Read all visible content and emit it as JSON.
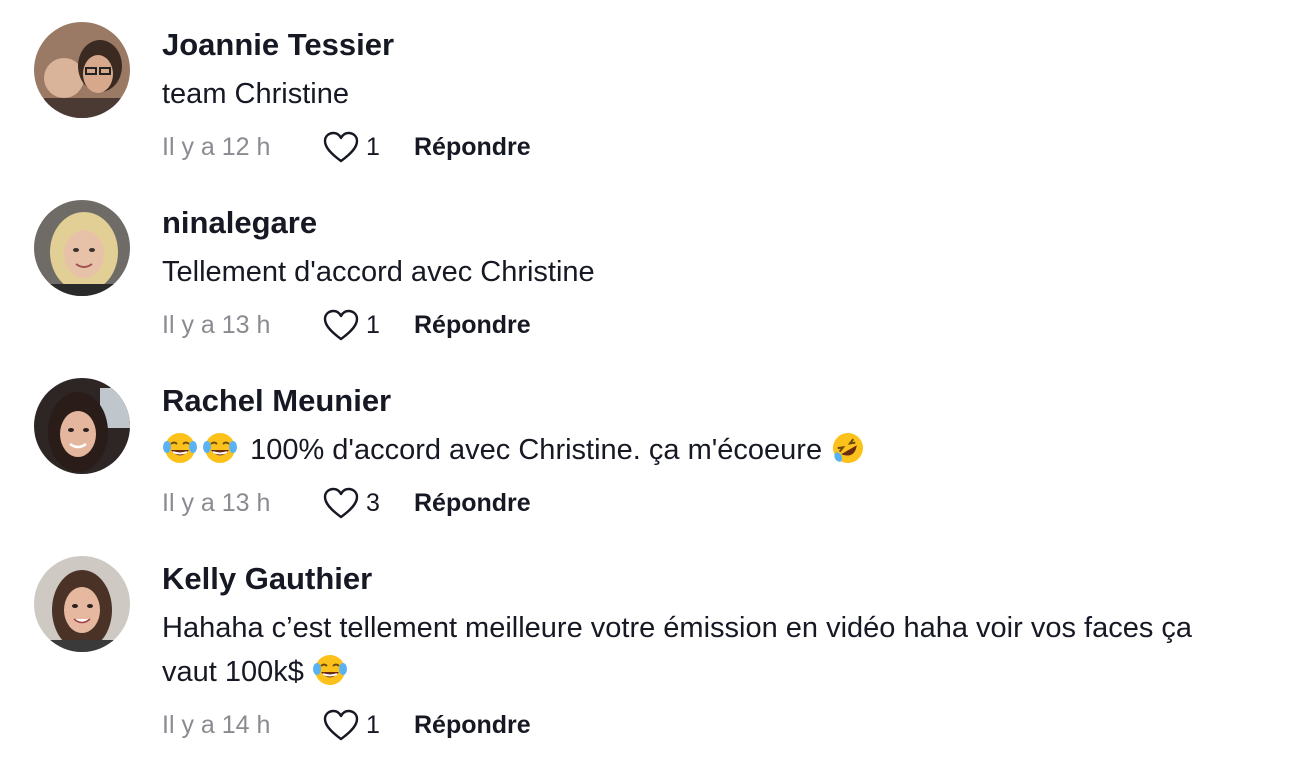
{
  "comments": [
    {
      "author": "Joannie Tessier",
      "text": "team Christine",
      "time": "Il y a 12 h",
      "likes": "1",
      "reply_label": "Répondre",
      "avatar_colors": {
        "bg": "#9a7a64",
        "skin": "#d8a88c",
        "hair": "#3a2a22"
      }
    },
    {
      "author": "ninalegare",
      "text": "Tellement d'accord avec Christine",
      "time": "Il y a 13 h",
      "likes": "1",
      "reply_label": "Répondre",
      "avatar_colors": {
        "bg": "#6f6b66",
        "skin": "#e8c2a8",
        "hair": "#e2cf96"
      }
    },
    {
      "author": "Rachel Meunier",
      "text_before": "",
      "text": "100% d'accord avec Christine. ça m'écoeure",
      "time": "Il y a 13 h",
      "likes": "3",
      "reply_label": "Répondre",
      "emojis": [
        "face-with-tears-of-joy",
        "face-with-tears-of-joy",
        "rolling-on-floor-laughing"
      ],
      "avatar_colors": {
        "bg": "#2e2624",
        "skin": "#e4b69e",
        "hair": "#2a1c18"
      }
    },
    {
      "author": "Kelly Gauthier",
      "text_line1": "Hahaha c’est tellement meilleure votre émission en vidéo haha voir vos faces ça",
      "text_line2": "vaut 100k$",
      "time": "Il y a 14 h",
      "likes": "1",
      "reply_label": "Répondre",
      "emojis": [
        "face-with-tears-of-joy"
      ],
      "avatar_colors": {
        "bg": "#cfc9c4",
        "skin": "#e6b8a0",
        "hair": "#4a3326"
      }
    }
  ],
  "icons": {
    "like": "heart-outline-icon"
  },
  "colors": {
    "text": "#161823",
    "muted": "#8a8b91",
    "emoji_face": "#fcc21b",
    "emoji_tear": "#5ab3f0"
  }
}
